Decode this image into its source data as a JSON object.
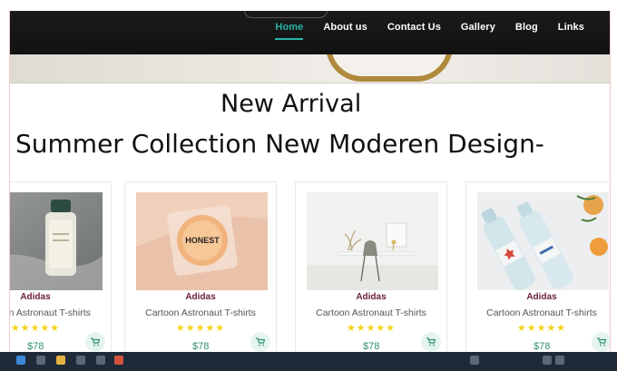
{
  "nav": {
    "links": [
      "Home",
      "About us",
      "Contact Us",
      "Gallery",
      "Blog",
      "Links"
    ],
    "active": "Home"
  },
  "headings": {
    "primary": "New Arrival",
    "secondary": "Summer Collection New Moderen Design-"
  },
  "products": [
    {
      "brand": "Adidas",
      "title": "Cartoon Astronaut T-shirts",
      "stars": "★★★★★",
      "price": "$78",
      "image": "perfume-bottle"
    },
    {
      "brand": "Adidas",
      "title": "Cartoon Astronaut T-shirts",
      "stars": "★★★★★",
      "price": "$78",
      "image": "honest-compact"
    },
    {
      "brand": "Adidas",
      "title": "Cartoon Astronaut T-shirts",
      "stars": "★★★★★",
      "price": "$78",
      "image": "desk-chair"
    },
    {
      "brand": "Adidas",
      "title": "Cartoon Astronaut T-shirts",
      "stars": "★★★★★",
      "price": "$78",
      "image": "water-bottles"
    }
  ],
  "product_image_text": {
    "honest": "HONEST"
  },
  "colors": {
    "accent": "#2ab3a6",
    "brand_text": "#6b1f3a",
    "price": "#2f8f6f",
    "star": "#f3d317",
    "nav_bg": "#161616"
  }
}
